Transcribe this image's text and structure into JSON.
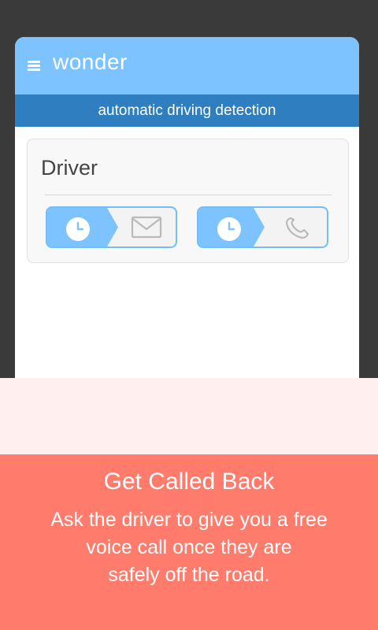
{
  "app": {
    "title": "wonder",
    "menu_icon": "hamburger-menu-icon",
    "subtitle": "automatic driving detection"
  },
  "driver_card": {
    "title": "Driver",
    "actions": [
      {
        "type": "message",
        "left_icon": "clock-icon",
        "right_icon": "envelope-icon"
      },
      {
        "type": "call",
        "left_icon": "clock-icon",
        "right_icon": "phone-icon"
      }
    ]
  },
  "promo": {
    "title": "Get Called Back",
    "line1": "Ask the driver to give you a free",
    "line2": "voice call once they are",
    "line3": "safely off the road."
  },
  "colors": {
    "app_bar": "#7cc3ff",
    "subtitle_bar": "#2f7ebf",
    "promo": "#ff7b6c",
    "light_panel": "#fff0ef",
    "action_border": "#73bdf8"
  }
}
